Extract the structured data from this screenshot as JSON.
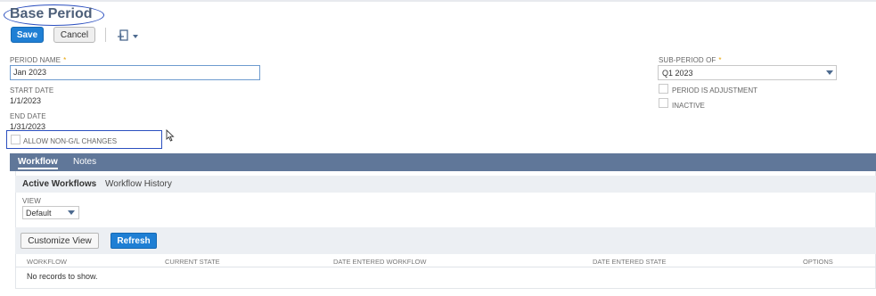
{
  "page": {
    "title": "Base Period"
  },
  "toolbar": {
    "save_label": "Save",
    "cancel_label": "Cancel",
    "actions_icon": "print-dropdown-icon"
  },
  "form": {
    "period_name": {
      "label": "PERIOD NAME",
      "required_mark": "*",
      "value": "Jan 2023"
    },
    "start_date": {
      "label": "START DATE",
      "value": "1/1/2023"
    },
    "end_date": {
      "label": "END DATE",
      "value": "1/31/2023"
    },
    "allow_non_gl": {
      "label": "ALLOW NON-G/L CHANGES",
      "checked": false
    },
    "sub_period_of": {
      "label": "SUB-PERIOD OF",
      "required_mark": "*",
      "value": "Q1 2023"
    },
    "period_is_adjustment": {
      "label": "PERIOD IS ADJUSTMENT",
      "checked": false
    },
    "inactive": {
      "label": "INACTIVE",
      "checked": false
    }
  },
  "tabs": [
    {
      "label": "Workflow",
      "active": true
    },
    {
      "label": "Notes",
      "active": false
    }
  ],
  "subtabs": [
    {
      "label": "Active Workflows",
      "active": true
    },
    {
      "label": "Workflow History",
      "active": false
    }
  ],
  "view": {
    "label": "VIEW",
    "value": "Default"
  },
  "list_toolbar": {
    "customize_label": "Customize View",
    "refresh_label": "Refresh"
  },
  "table": {
    "columns": [
      "WORKFLOW",
      "CURRENT STATE",
      "DATE ENTERED WORKFLOW",
      "DATE ENTERED STATE",
      "OPTIONS"
    ],
    "empty_message": "No records to show."
  },
  "colors": {
    "accent": "#1f7fd4",
    "tabbar": "#607799",
    "annotation": "#2b4fbf",
    "required": "#e8a200"
  }
}
